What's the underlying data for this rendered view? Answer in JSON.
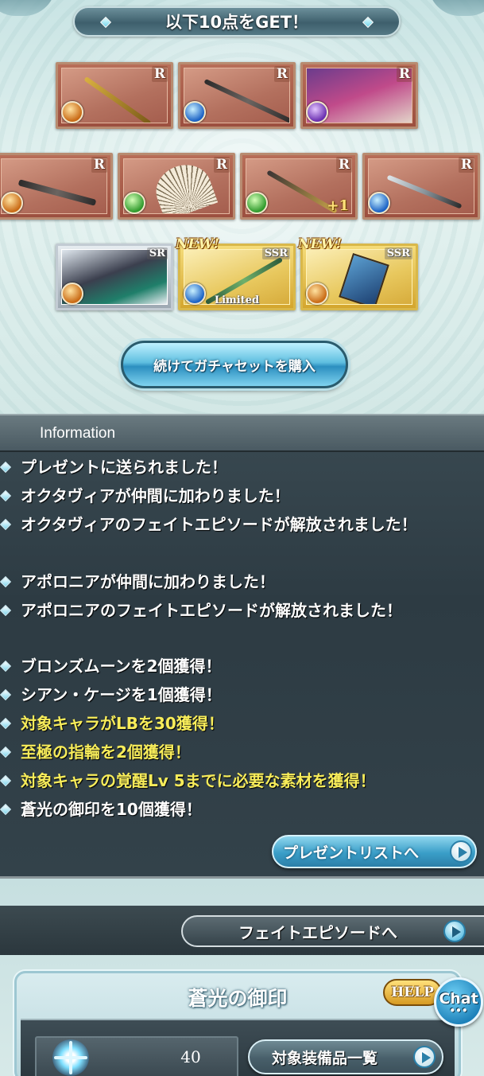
{
  "gacha": {
    "banner_text": "以下10点をGET！",
    "items": [
      {
        "rarity": "R",
        "element": "fire",
        "kind": "staff"
      },
      {
        "rarity": "R",
        "element": "water",
        "kind": "spear"
      },
      {
        "rarity": "R",
        "element": "dark",
        "kind": "summon"
      },
      {
        "rarity": "R",
        "element": "fire",
        "kind": "gun"
      },
      {
        "rarity": "R",
        "element": "wind",
        "kind": "fan"
      },
      {
        "rarity": "R",
        "element": "wind",
        "kind": "axe",
        "badge": "+1"
      },
      {
        "rarity": "R",
        "element": "water",
        "kind": "katana"
      },
      {
        "rarity": "SR",
        "element": "fire",
        "kind": "character"
      },
      {
        "rarity": "SSR",
        "element": "water",
        "kind": "sword",
        "new": "NEW!",
        "label": "Limited"
      },
      {
        "rarity": "SSR",
        "element": "fire",
        "kind": "book",
        "new": "NEW!"
      }
    ],
    "continue_button": "続けてガチャセットを購入"
  },
  "information": {
    "title": "Information",
    "lines": [
      {
        "text": "プレゼントに送られました！",
        "highlight": false
      },
      {
        "text": "オクタヴィアが仲間に加わりました！",
        "highlight": false
      },
      {
        "text": "オクタヴィアのフェイトエピソードが解放されました！",
        "highlight": false
      },
      {
        "text": "アポロニアが仲間に加わりました！",
        "highlight": false
      },
      {
        "text": "アポロニアのフェイトエピソードが解放されました！",
        "highlight": false
      },
      {
        "text": "ブロンズムーンを2個獲得！",
        "highlight": false
      },
      {
        "text": "シアン・ケージを1個獲得！",
        "highlight": false
      },
      {
        "text": "対象キャラがLBを30獲得！",
        "highlight": true
      },
      {
        "text": "至極の指輪を2個獲得！",
        "highlight": true
      },
      {
        "text": "対象キャラの覚醒Lv 5までに必要な素材を獲得！",
        "highlight": true
      },
      {
        "text": "蒼光の御印を10個獲得！",
        "highlight": false
      }
    ],
    "present_list_button": "プレゼントリストへ"
  },
  "fate_episode_button": "フェイトエピソードへ",
  "seal_panel": {
    "title": "蒼光の御印",
    "help_button": "HELP",
    "chat_button": "Chat",
    "chat_dots": "•••",
    "count": "40",
    "target_equipment_button": "対象装備品一覧"
  },
  "colors": {
    "highlight_text": "#f7ec5a",
    "normal_text": "#ffffff",
    "panel_bg": "#2d3b43"
  }
}
